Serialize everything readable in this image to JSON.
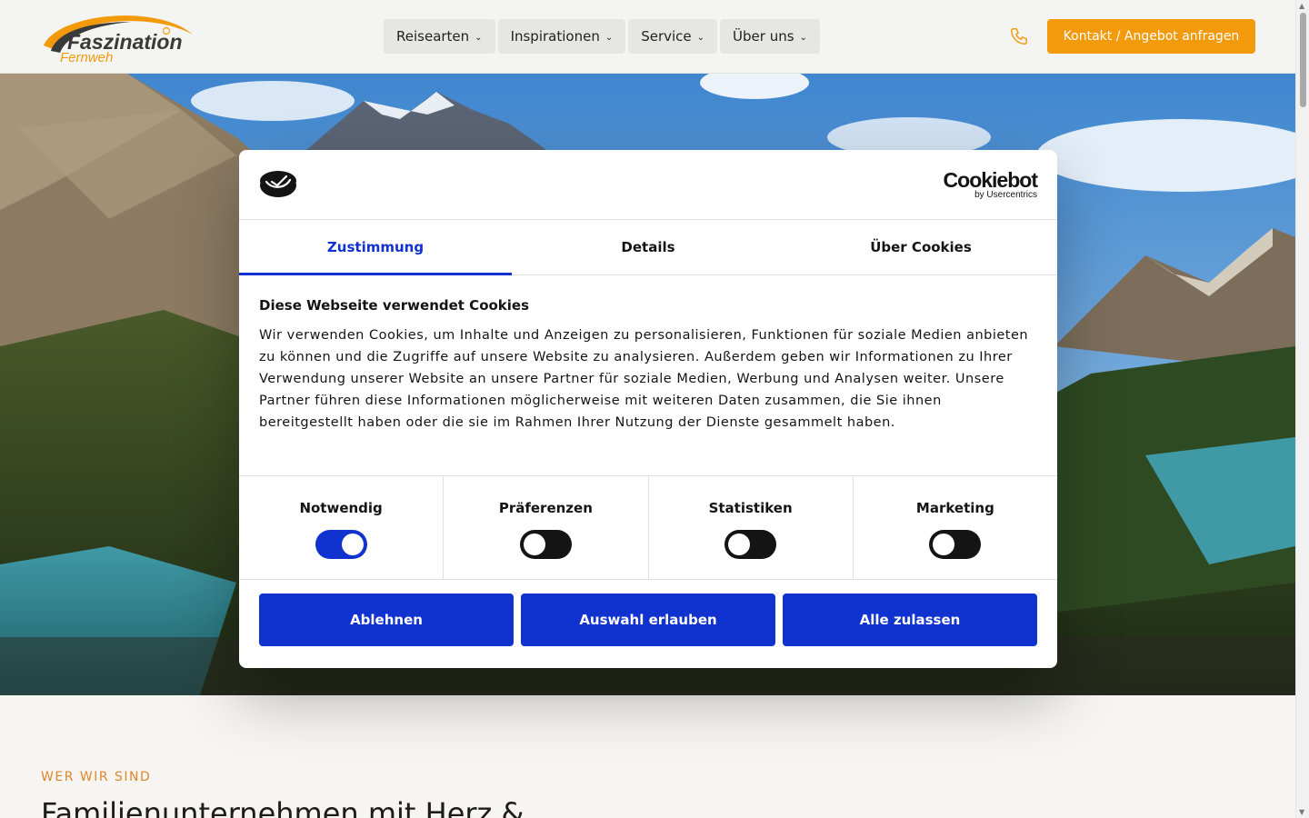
{
  "brand": {
    "logo_line1": "Faszination",
    "logo_line2": "Fernweh"
  },
  "nav": {
    "items": [
      {
        "label": "Reisearten"
      },
      {
        "label": "Inspirationen"
      },
      {
        "label": "Service"
      },
      {
        "label": "Über uns"
      }
    ],
    "phone_icon": "phone-icon",
    "cta_label": "Kontakt / Angebot anfragen"
  },
  "colors": {
    "accent_orange": "#f39a0b",
    "cookie_blue": "#1032cf"
  },
  "cookie_dialog": {
    "provider_name": "Cookiebot",
    "provider_sub": "by Usercentrics",
    "tabs": [
      {
        "label": "Zustimmung",
        "active": true
      },
      {
        "label": "Details",
        "active": false
      },
      {
        "label": "Über Cookies",
        "active": false
      }
    ],
    "title": "Diese Webseite verwendet Cookies",
    "text": "Wir verwenden Cookies, um Inhalte und Anzeigen zu personalisieren, Funktionen für soziale Medien anbieten zu können und die Zugriffe auf unsere Website zu analysieren. Außerdem geben wir Informationen zu Ihrer Verwendung unserer Website an unsere Partner für soziale Medien, Werbung und Analysen weiter. Unsere Partner führen diese Informationen möglicherweise mit weiteren Daten zusammen, die Sie ihnen bereitgestellt haben oder die sie im Rahmen Ihrer Nutzung der Dienste gesammelt haben.",
    "toggles": [
      {
        "label": "Notwendig",
        "checked": true
      },
      {
        "label": "Präferenzen",
        "checked": false
      },
      {
        "label": "Statistiken",
        "checked": false
      },
      {
        "label": "Marketing",
        "checked": false
      }
    ],
    "buttons": {
      "decline": "Ablehnen",
      "allow_selection": "Auswahl erlauben",
      "allow_all": "Alle zulassen"
    }
  },
  "section": {
    "eyebrow": "WER WIR SIND",
    "title": "Familienunternehmen mit Herz &"
  }
}
